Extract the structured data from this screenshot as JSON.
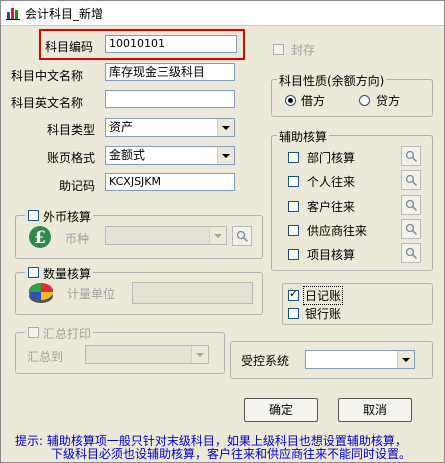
{
  "window": {
    "title": "会计科目_新增"
  },
  "fields": {
    "code": {
      "label": "科目编码",
      "value": "10010101"
    },
    "cn_name": {
      "label": "科目中文名称",
      "value": "库存现金三级科目"
    },
    "en_name": {
      "label": "科目英文名称",
      "value": ""
    },
    "type": {
      "label": "科目类型",
      "value": "资产"
    },
    "ledger": {
      "label": "账页格式",
      "value": "金额式"
    },
    "mnemonic": {
      "label": "助记码",
      "value": "KCXJSJKM"
    }
  },
  "seal": {
    "label": "封存",
    "checked": false,
    "enabled": false
  },
  "nature": {
    "title": "科目性质(余额方向)",
    "debit": "借方",
    "credit": "贷方",
    "selected": "debit"
  },
  "aux": {
    "title": "辅助核算",
    "items": [
      {
        "label": "部门核算"
      },
      {
        "label": "个人往来"
      },
      {
        "label": "客户往来"
      },
      {
        "label": "供应商往来"
      },
      {
        "label": "项目核算"
      }
    ]
  },
  "foreign": {
    "title": "外币核算",
    "currency_label": "币种",
    "currency_value": ""
  },
  "quantity": {
    "title": "数量核算",
    "unit_label": "计量单位",
    "unit_value": ""
  },
  "summary": {
    "title": "汇总打印",
    "to_label": "汇总到"
  },
  "journal": {
    "label": "日记账",
    "checked": true
  },
  "bank": {
    "label": "银行账",
    "checked": false
  },
  "control": {
    "label": "受控系统",
    "value": ""
  },
  "buttons": {
    "ok": "确定",
    "cancel": "取消"
  },
  "hint": {
    "line1": "提示: 辅助核算项一般只针对末级科目，如果上级科目也想设置辅助核算，",
    "line2": "下级科目必须也设辅助核算，客户往来和供应商往来不能同时设置。"
  }
}
